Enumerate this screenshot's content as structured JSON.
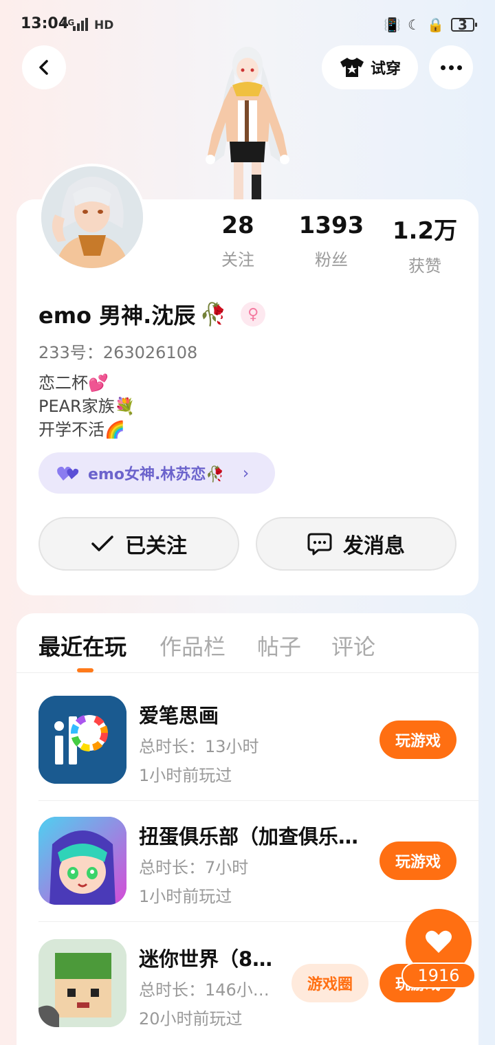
{
  "status_bar": {
    "time": "13:04",
    "network": "4G",
    "hd": "HD",
    "battery": "3"
  },
  "header": {
    "tryon_label": "试穿"
  },
  "profile": {
    "stats": [
      {
        "value": "28",
        "label": "关注"
      },
      {
        "value": "1393",
        "label": "粉丝"
      },
      {
        "value": "1.2万",
        "label": "获赞"
      }
    ],
    "username": "emo 男神.沈辰",
    "username_emoji": "🥀",
    "gender_symbol": "♀",
    "account_id": "233号：263026108",
    "bio_lines": [
      "恋二杯💕",
      "PEAR家族💐",
      "开学不活🌈"
    ],
    "couple_tag": "emo女神.林苏恋🥀",
    "follow_button": "已关注",
    "message_button": "发消息"
  },
  "tabs": [
    "最近在玩",
    "作品栏",
    "帖子",
    "评论"
  ],
  "games": [
    {
      "name": "爱笔思画",
      "duration": "总时长：13小时",
      "last_played": "1小时前玩过",
      "play_label": "玩游戏"
    },
    {
      "name": "扭蛋俱乐部（加查俱乐…",
      "duration": "总时长：7小时",
      "last_played": "1小时前玩过",
      "play_label": "玩游戏"
    },
    {
      "name": "迷你世界（8…",
      "duration": "总时长：146小…",
      "last_played": "20小时前玩过",
      "circle_label": "游戏圈",
      "play_label": "玩游戏"
    }
  ],
  "like_count": "1916",
  "colors": {
    "accent": "#ff6f12",
    "couple": "#6b63cc"
  }
}
